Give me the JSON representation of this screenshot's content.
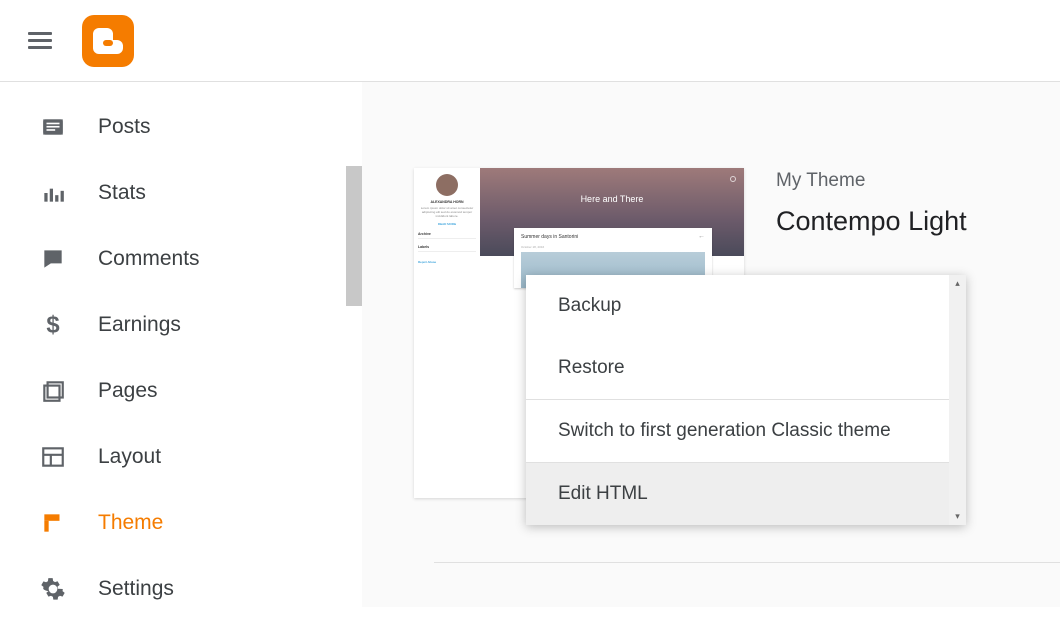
{
  "sidebar": {
    "items": [
      {
        "label": "Posts",
        "icon": "posts"
      },
      {
        "label": "Stats",
        "icon": "stats"
      },
      {
        "label": "Comments",
        "icon": "comments"
      },
      {
        "label": "Earnings",
        "icon": "earnings"
      },
      {
        "label": "Pages",
        "icon": "pages"
      },
      {
        "label": "Layout",
        "icon": "layout"
      },
      {
        "label": "Theme",
        "icon": "theme",
        "active": true
      },
      {
        "label": "Settings",
        "icon": "settings"
      }
    ]
  },
  "theme": {
    "section_label": "My Theme",
    "name": "Contempo Light",
    "preview": {
      "hero_title": "Here and There",
      "author_name": "ALEXANDRA HORN",
      "card_title": "Summer days in Santorini",
      "card_date": "October 18, 2016",
      "sidebar_archive": "Archive",
      "sidebar_labels": "Labels",
      "report_link": "Report Abuse"
    }
  },
  "menu": {
    "items": [
      {
        "label": "Backup"
      },
      {
        "label": "Restore"
      },
      {
        "label": "Switch to first generation Classic theme",
        "divider_before": true
      },
      {
        "label": "Edit HTML",
        "divider_before": true,
        "hover": true
      }
    ]
  }
}
